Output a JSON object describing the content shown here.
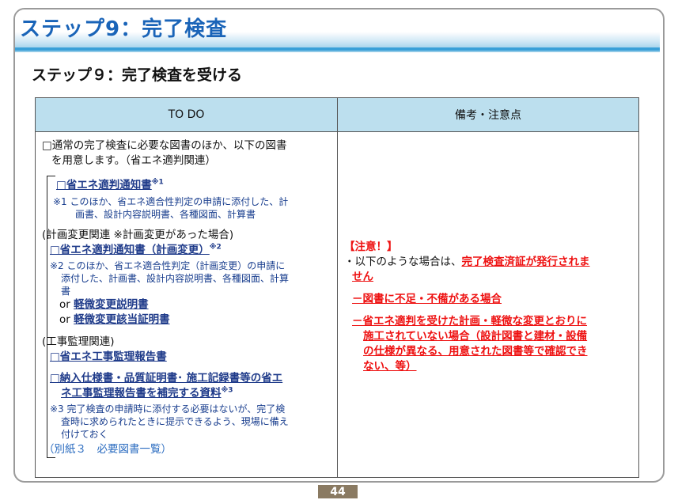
{
  "header": {
    "title": "ステップ9：完了検査",
    "subtitle": "ステップ９：完了検査を受ける"
  },
  "table": {
    "headers": [
      "TO DO",
      "備考・注意点"
    ],
    "left": {
      "intro_1": "□通常の完了検査に必要な図書のほか、以下の図書",
      "intro_2": "を用意します。（省エネ適判関連）",
      "item1_label": "□省エネ適判通知書",
      "item1_sup": "※1",
      "note1_line1": "※1 このほか、省エネ適合性判定の申請に添付した、計",
      "note1_line2": "画書、設計内容説明書、各種図面、計算書",
      "plan_change_heading": "(計画変更関連 ※計画変更があった場合)",
      "item2_label": "□省エネ適判通知書（計画変更）",
      "item2_sup": "※2",
      "note2_line1": "※2 このほか、省エネ適合性判定（計画変更）の申請に",
      "note2_line2": "添付した、計画書、設計内容説明書、各種図面、計算",
      "note2_line3": "書",
      "or_1_prefix": "or",
      "or_1_label": "軽微変更説明書",
      "or_2_prefix": "or",
      "or_2_label": "軽微変更該当証明書",
      "supervision_heading": "(工事監理関連)",
      "item3_label": "□省エネ工事監理報告書",
      "item4_line1": "□納入仕様書・品質証明書･ 施工記録書等の省エ",
      "item4_line2": "ネ工事監理報告書を補完する資料",
      "item4_sup": "※3",
      "note3_line1": "※3 完了検査の申請時に添付する必要はないが、完了検",
      "note3_line2": "査時に求められたときに提示できるよう、現場に備え",
      "note3_line3": "付けておく",
      "reference": "（別紙３　必要図書一覧）"
    },
    "right": {
      "caution": "【注意！】",
      "bullet_prefix": "・以下のような場合は、",
      "bullet_emph_1": "完了検査済証が発行されま",
      "bullet_emph_2": "せん",
      "case1": "－図書に不足・不備がある場合",
      "case2_line1": "－省エネ適判を受けた計画・軽微な変更とおりに",
      "case2_line2": "施工されていない場合（設計図書と建材・設備",
      "case2_line3": "の仕様が異なる、用意された図書等で確認でき",
      "case2_line4": "ない、等）"
    }
  },
  "footer": {
    "page_number": "44"
  },
  "colors": {
    "title_blue": "#1a64b8",
    "header_fill": "#bcdfee",
    "caution_red": "#e11111",
    "link_navy": "#1f3b8a",
    "page_badge": "#8a7a62"
  }
}
